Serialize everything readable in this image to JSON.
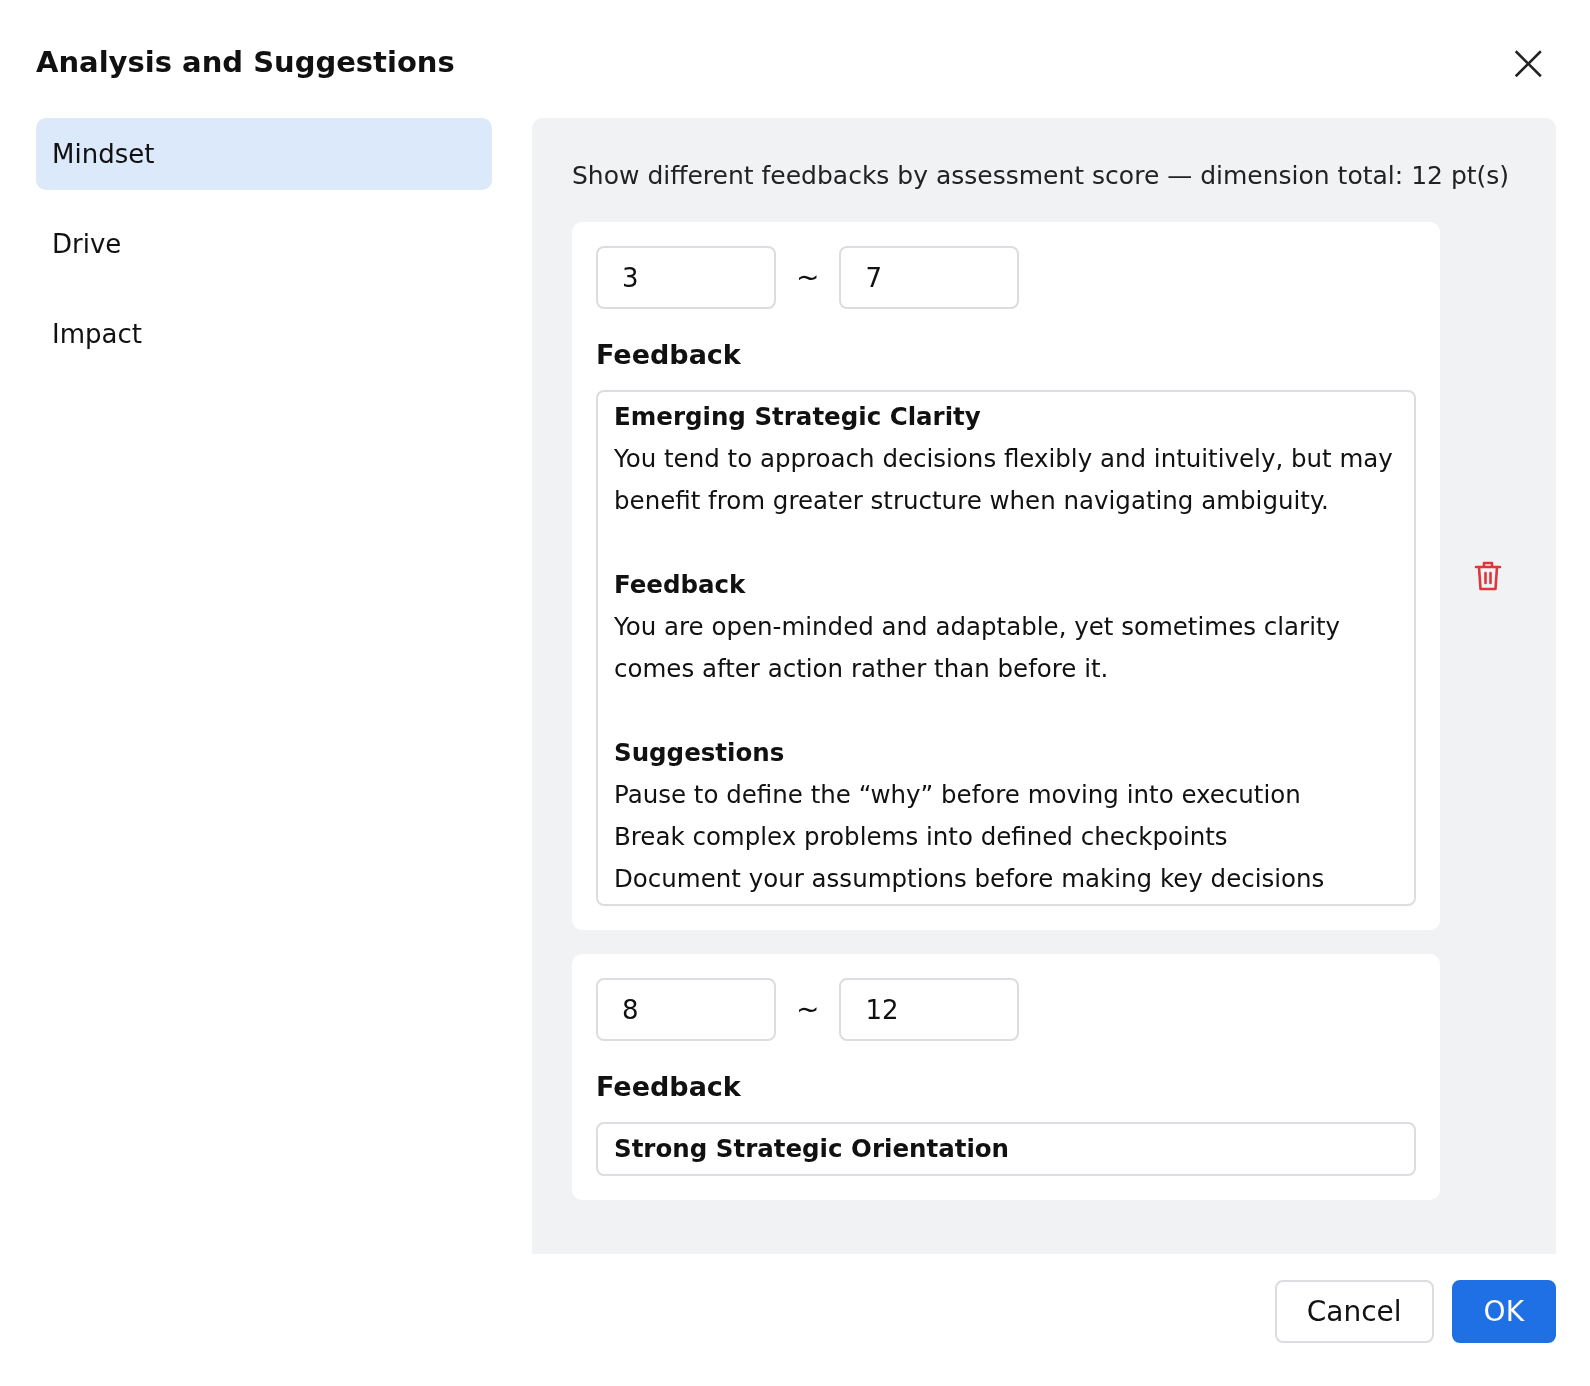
{
  "dialog": {
    "title": "Analysis and Suggestions",
    "close": "×"
  },
  "sidebar": {
    "items": [
      {
        "label": "Mindset",
        "selected": true
      },
      {
        "label": "Drive",
        "selected": false
      },
      {
        "label": "Impact",
        "selected": false
      }
    ]
  },
  "panel": {
    "description": "Show different feedbacks by assessment score — dimension total: 12 pt(s)",
    "ranges": [
      {
        "min": "3",
        "separator": "~",
        "max": "7",
        "feedback_label": "Feedback",
        "deletable": true,
        "sections": [
          {
            "heading": "Emerging Strategic Clarity",
            "lines": [
              "You tend to approach decisions flexibly and intuitively, but may benefit from greater structure when navigating ambiguity."
            ]
          },
          {
            "heading": "Feedback",
            "lines": [
              "You are open-minded and adaptable, yet sometimes clarity comes after action rather than before it."
            ]
          },
          {
            "heading": "Suggestions",
            "lines": [
              "Pause to define the “why” before moving into execution",
              "Break complex problems into defined checkpoints",
              "Document your assumptions before making key decisions"
            ]
          }
        ]
      },
      {
        "min": "8",
        "separator": "~",
        "max": "12",
        "feedback_label": "Feedback",
        "deletable": false,
        "sections": [
          {
            "heading": "Strong Strategic Orientation"
          }
        ]
      }
    ]
  },
  "buttons": [
    {
      "label": "Cancel",
      "kind": "secondary"
    },
    {
      "label": "OK",
      "kind": "primary"
    }
  ]
}
